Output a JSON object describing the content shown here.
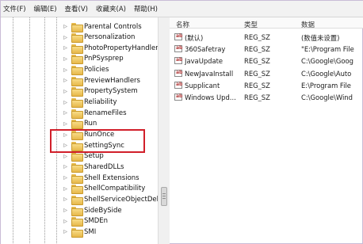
{
  "menu": [
    "文件(F)",
    "编辑(E)",
    "查看(V)",
    "收藏夹(A)",
    "帮助(H)"
  ],
  "tree_items": [
    {
      "label": "Parental Controls",
      "top": 0
    },
    {
      "label": "Personalization",
      "top": 0
    },
    {
      "label": "PhotoPropertyHandler",
      "top": 0
    },
    {
      "label": "PnPSysprep",
      "top": 0
    },
    {
      "label": "Policies",
      "top": 0
    },
    {
      "label": "PreviewHandlers",
      "top": 0
    },
    {
      "label": "PropertySystem",
      "top": 0
    },
    {
      "label": "Reliability",
      "top": 0
    },
    {
      "label": "RenameFiles",
      "top": 0
    },
    {
      "label": "Run",
      "top": 0
    },
    {
      "label": "RunOnce",
      "top": 0
    },
    {
      "label": "SettingSync",
      "top": 0
    },
    {
      "label": "Setup",
      "top": 0
    },
    {
      "label": "SharedDLLs",
      "top": 0
    },
    {
      "label": "Shell Extensions",
      "top": 0
    },
    {
      "label": "ShellCompatibility",
      "top": 0
    },
    {
      "label": "ShellServiceObjectDelay",
      "top": 0
    },
    {
      "label": "SideBySide",
      "top": 0
    },
    {
      "label": "SMDEn",
      "top": 0
    },
    {
      "label": "SMI",
      "top": 0
    }
  ],
  "columns": {
    "name": "名称",
    "type": "类型",
    "data": "数据"
  },
  "values": [
    {
      "name": "(默认)",
      "type": "REG_SZ",
      "data": "(数值未设置)"
    },
    {
      "name": "360Safetray",
      "type": "REG_SZ",
      "data": "\"E:\\Program File"
    },
    {
      "name": "JavaUpdate",
      "type": "REG_SZ",
      "data": "C:\\Google\\Goog"
    },
    {
      "name": "NewJavaInstall",
      "type": "REG_SZ",
      "data": "C:\\Google\\Auto"
    },
    {
      "name": "Supplicant",
      "type": "REG_SZ",
      "data": "E:\\Program File"
    },
    {
      "name": "Windows Upd...",
      "type": "REG_SZ",
      "data": "C:\\Google\\Wind"
    }
  ],
  "accent": "#d11f2a"
}
